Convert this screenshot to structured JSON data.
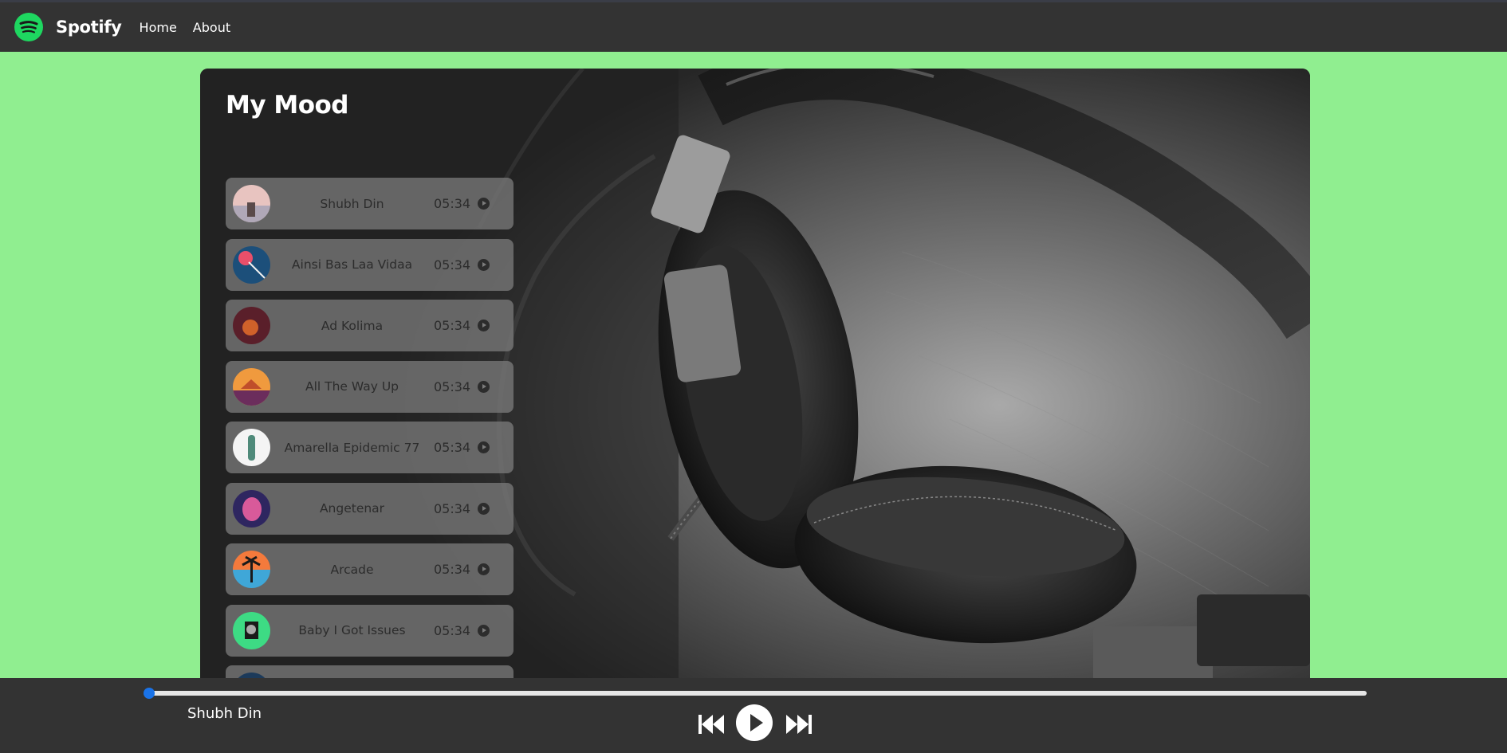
{
  "navbar": {
    "brand": "Spotify",
    "logo_icon": "spotify-logo-icon",
    "links": [
      "Home",
      "About"
    ]
  },
  "main": {
    "title": "My Mood",
    "background_icon": "headphones-image",
    "songs": [
      {
        "name": "Shubh Din",
        "duration": "05:34",
        "cover_colors": [
          "#e8c4c0",
          "#b0a8b8"
        ]
      },
      {
        "name": "Ainsi Bas Laa Vidaa",
        "duration": "05:34",
        "cover_colors": [
          "#1c4f7a",
          "#e94f6a"
        ]
      },
      {
        "name": "Ad Kolima",
        "duration": "05:34",
        "cover_colors": [
          "#5a1f2a",
          "#d0612a"
        ]
      },
      {
        "name": "All The Way Up",
        "duration": "05:34",
        "cover_colors": [
          "#f09a3e",
          "#6b2d5c"
        ]
      },
      {
        "name": "Amarella Epidemic 77",
        "duration": "05:34",
        "cover_colors": [
          "#f4f4f4",
          "#4f8a7a"
        ]
      },
      {
        "name": "Angetenar",
        "duration": "05:34",
        "cover_colors": [
          "#2e2660",
          "#d85a9a"
        ]
      },
      {
        "name": "Arcade",
        "duration": "05:34",
        "cover_colors": [
          "#f47a3c",
          "#3fa7d8"
        ]
      },
      {
        "name": "Baby I Got Issues",
        "duration": "05:34",
        "cover_colors": [
          "#3ddb84",
          "#1a1a1a"
        ]
      },
      {
        "name": "",
        "duration": "",
        "cover_colors": [
          "#1c3a5a",
          "#0e2233"
        ]
      }
    ]
  },
  "player": {
    "now_playing": "Shubh Din",
    "progress": 0,
    "accent": "#1a73e8",
    "icons": [
      "previous-track-icon",
      "play-icon",
      "next-track-icon"
    ]
  },
  "colors": {
    "page_bg": "#90ee90",
    "navbar_bg": "#333333",
    "brand_green": "#1ed760"
  }
}
